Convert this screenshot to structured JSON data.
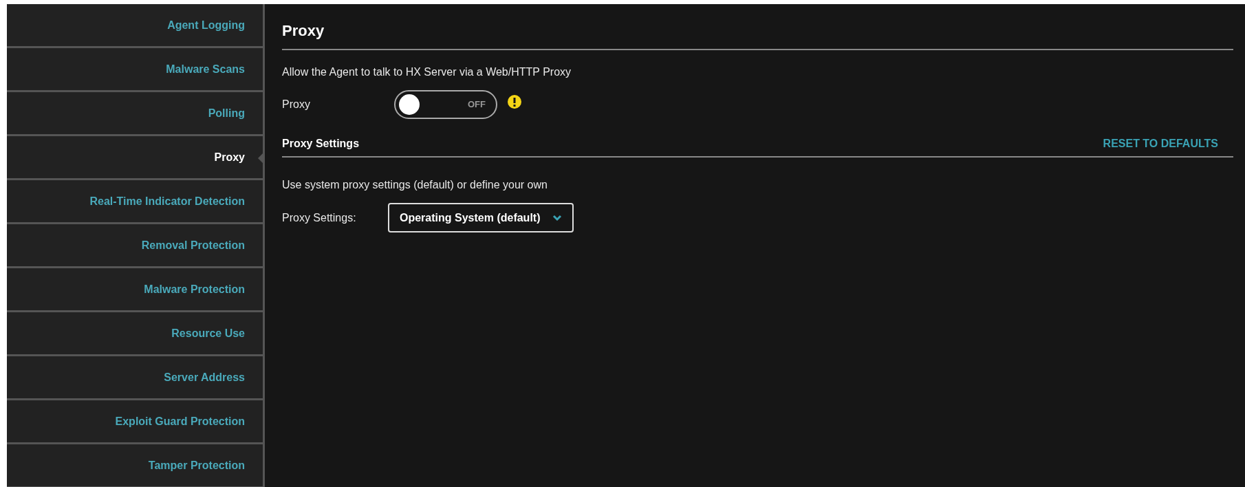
{
  "sidebar": {
    "items": [
      {
        "label": "Agent Logging",
        "selected": false
      },
      {
        "label": "Malware Scans",
        "selected": false
      },
      {
        "label": "Polling",
        "selected": false
      },
      {
        "label": "Proxy",
        "selected": true
      },
      {
        "label": "Real-Time Indicator Detection",
        "selected": false
      },
      {
        "label": "Removal Protection",
        "selected": false
      },
      {
        "label": "Malware Protection",
        "selected": false
      },
      {
        "label": "Resource Use",
        "selected": false
      },
      {
        "label": "Server Address",
        "selected": false
      },
      {
        "label": "Exploit Guard Protection",
        "selected": false
      },
      {
        "label": "Tamper Protection",
        "selected": false
      }
    ]
  },
  "main": {
    "title": "Proxy",
    "description": "Allow the Agent to talk to HX Server via a Web/HTTP Proxy",
    "toggle": {
      "label": "Proxy",
      "on": false,
      "state_text": "OFF",
      "warning": true
    },
    "settings": {
      "title": "Proxy Settings",
      "reset": "RESET TO DEFAULTS",
      "description": "Use system proxy settings (default) or define your own",
      "select_label": "Proxy Settings:",
      "select_value": "Operating System (default)"
    }
  }
}
